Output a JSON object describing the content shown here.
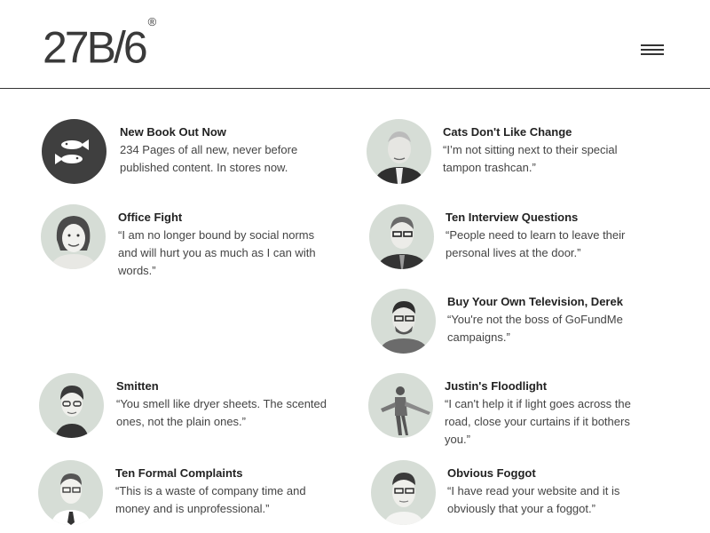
{
  "header": {
    "logo_text": "27B/6",
    "logo_mark": "®",
    "menu_icon": "hamburger-menu-icon"
  },
  "left_items": [
    {
      "title": "New Book Out Now",
      "desc": "234 Pages of all new, never before published content. In stores now.",
      "icon": "fish-icon"
    },
    {
      "title": "Office Fight",
      "desc": "“I am no longer bound by social norms and will hurt you as much as I can with words.”"
    },
    {
      "title": "Smitten",
      "desc": "“You smell like dryer sheets. The scented ones, not the plain ones.”"
    },
    {
      "title": "Ten Formal Complaints",
      "desc": "“This is a waste of company time and money and is unprofessional.”"
    }
  ],
  "right_items": [
    {
      "title": "Cats Don't Like Change",
      "desc": "“I’m not sitting next to their special tampon trashcan.”"
    },
    {
      "title": "Ten Interview Questions",
      "desc": "“People need to learn to leave their personal lives at the door.”"
    },
    {
      "title": "Buy Your Own Television, Derek",
      "desc": "“You're not the boss of GoFundMe campaigns.”"
    },
    {
      "title": "Justin's Floodlight",
      "desc": "“I can't help it if light goes across the road, close your curtains if it bothers you.”"
    },
    {
      "title": "Obvious Foggot",
      "desc": "“I have read your website and it is obviously that your a foggot.”"
    }
  ]
}
